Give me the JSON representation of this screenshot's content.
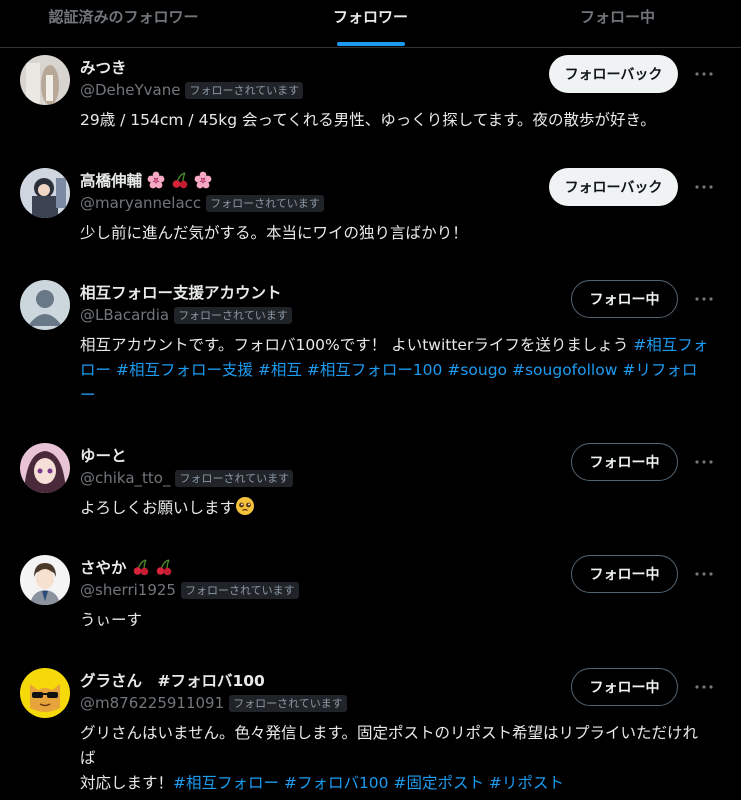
{
  "tabs": [
    "認証済みのフォロワー",
    "フォロワー",
    "フォロー中"
  ],
  "users": [
    {
      "name": "みつき",
      "handle": "@DeheYvane",
      "follows_you": "フォローされています",
      "button": "フォローバック",
      "bio": "29歳 / 154cm / 45kg 会ってくれる男性、ゆっくり探してます。夜の散歩が好き。"
    },
    {
      "name": "高橋伸輔",
      "name_emoji": [
        "sakura-icon",
        "cherry-icon",
        "sakura-icon"
      ],
      "handle": "@maryannelacc",
      "follows_you": "フォローされています",
      "button": "フォローバック",
      "bio": "少し前に進んだ気がする。本当にワイの独り言ばかり！"
    },
    {
      "name": "相互フォロー支援アカウント",
      "handle": "@LBacardia",
      "follows_you": "フォローされています",
      "button": "フォロー中",
      "bio_line1": "相互アカウントです。フォロバ100%です！ よいtwitterライフを送りましょう",
      "hashtags": [
        "#相互フォロー",
        "#相互フォロー支援",
        "#相互",
        "#相互フォロー100",
        "#sougo",
        "#sougofollow",
        "#リフォロー"
      ]
    },
    {
      "name": "ゆーと",
      "handle": "@chika_tto_",
      "follows_you": "フォローされています",
      "button": "フォロー中",
      "bio": "よろしくお願いします",
      "bio_emoji": "pleading-face-icon"
    },
    {
      "name": "さやか",
      "name_emoji": [
        "cherry-icon",
        "cherry-icon"
      ],
      "handle": "@sherri1925",
      "follows_you": "フォローされています",
      "button": "フォロー中",
      "bio": "うぃーす"
    },
    {
      "name": "グラさん　#フォロバ100",
      "handle": "@m876225911091",
      "follows_you": "フォローされています",
      "button": "フォロー中",
      "bio_line1": "グリさんはいません。色々発信します。固定ポストのリポスト希望はリプライいただければ",
      "bio_line2": "対応します！",
      "hashtags": [
        "#相互フォロー",
        "#フォロバ100",
        "#固定ポスト",
        "#リポスト"
      ]
    }
  ],
  "colors": {
    "accent": "#1d9bf0",
    "muted": "#71767b",
    "text": "#e7e9ea",
    "background": "#000000"
  }
}
